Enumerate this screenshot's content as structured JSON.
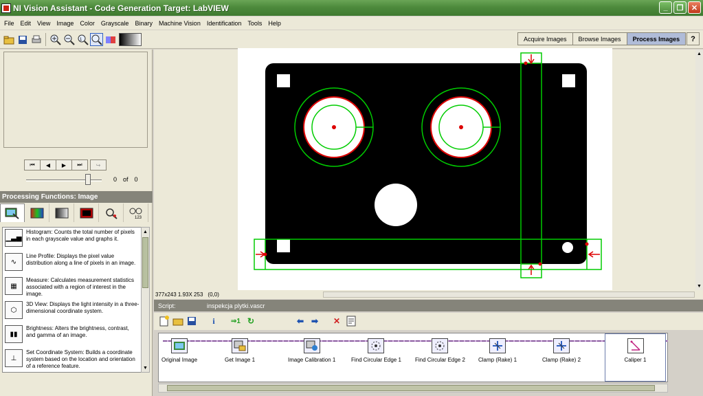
{
  "window": {
    "title": "NI Vision Assistant - Code Generation Target: LabVIEW",
    "minimize": "_",
    "maximize": "❐",
    "close": "✕"
  },
  "menu": [
    "File",
    "Edit",
    "View",
    "Image",
    "Color",
    "Grayscale",
    "Binary",
    "Machine Vision",
    "Identification",
    "Tools",
    "Help"
  ],
  "mode_tabs": [
    "Acquire Images",
    "Browse Images",
    "Process Images"
  ],
  "help_label": "?",
  "browser": {
    "nav": [
      "⏮",
      "◀",
      "▶",
      "⏭",
      "↪"
    ],
    "counter": {
      "current": "0",
      "of": "of",
      "total": "0"
    }
  },
  "processing": {
    "header": "Processing Functions: Image",
    "functions": [
      {
        "icon": "histogram-icon",
        "glyph": "▁▃▅",
        "text": "Histogram:  Counts the total number of pixels in each grayscale value and graphs it."
      },
      {
        "icon": "line-profile-icon",
        "glyph": "∿",
        "text": "Line Profile:  Displays the pixel value distribution along a line of pixels in an image."
      },
      {
        "icon": "measure-icon",
        "glyph": "▦",
        "text": "Measure:  Calculates measurement statistics associated with a region of interest in the image."
      },
      {
        "icon": "3d-view-icon",
        "glyph": "⬡",
        "text": "3D View:  Displays the light intensity in a three-dimensional coordinate system."
      },
      {
        "icon": "brightness-icon",
        "glyph": "▮▮",
        "text": "Brightness:  Alters the brightness, contrast, and gamma of an image."
      },
      {
        "icon": "coordinate-system-icon",
        "glyph": "⊥",
        "text": "Set Coordinate System:  Builds a coordinate system based on the location and orientation of a reference feature."
      }
    ]
  },
  "status": {
    "image_info": "377x243 1.93X 253",
    "coords": "(0,0)"
  },
  "script": {
    "label": "Script:",
    "filename": "inspekcja plytki.vascr",
    "steps": [
      "Original Image",
      "Get Image 1",
      "Image Calibration 1",
      "Find Circular Edge 1",
      "Find Circular Edge 2",
      "Clamp (Rake) 1",
      "Clamp (Rake) 2",
      "Caliper 1"
    ]
  },
  "colors": {
    "titlebar": "#4d8a3c",
    "overlay_green": "#00cc00",
    "overlay_red": "#dd0000",
    "active_tab": "#b0bcd8"
  }
}
